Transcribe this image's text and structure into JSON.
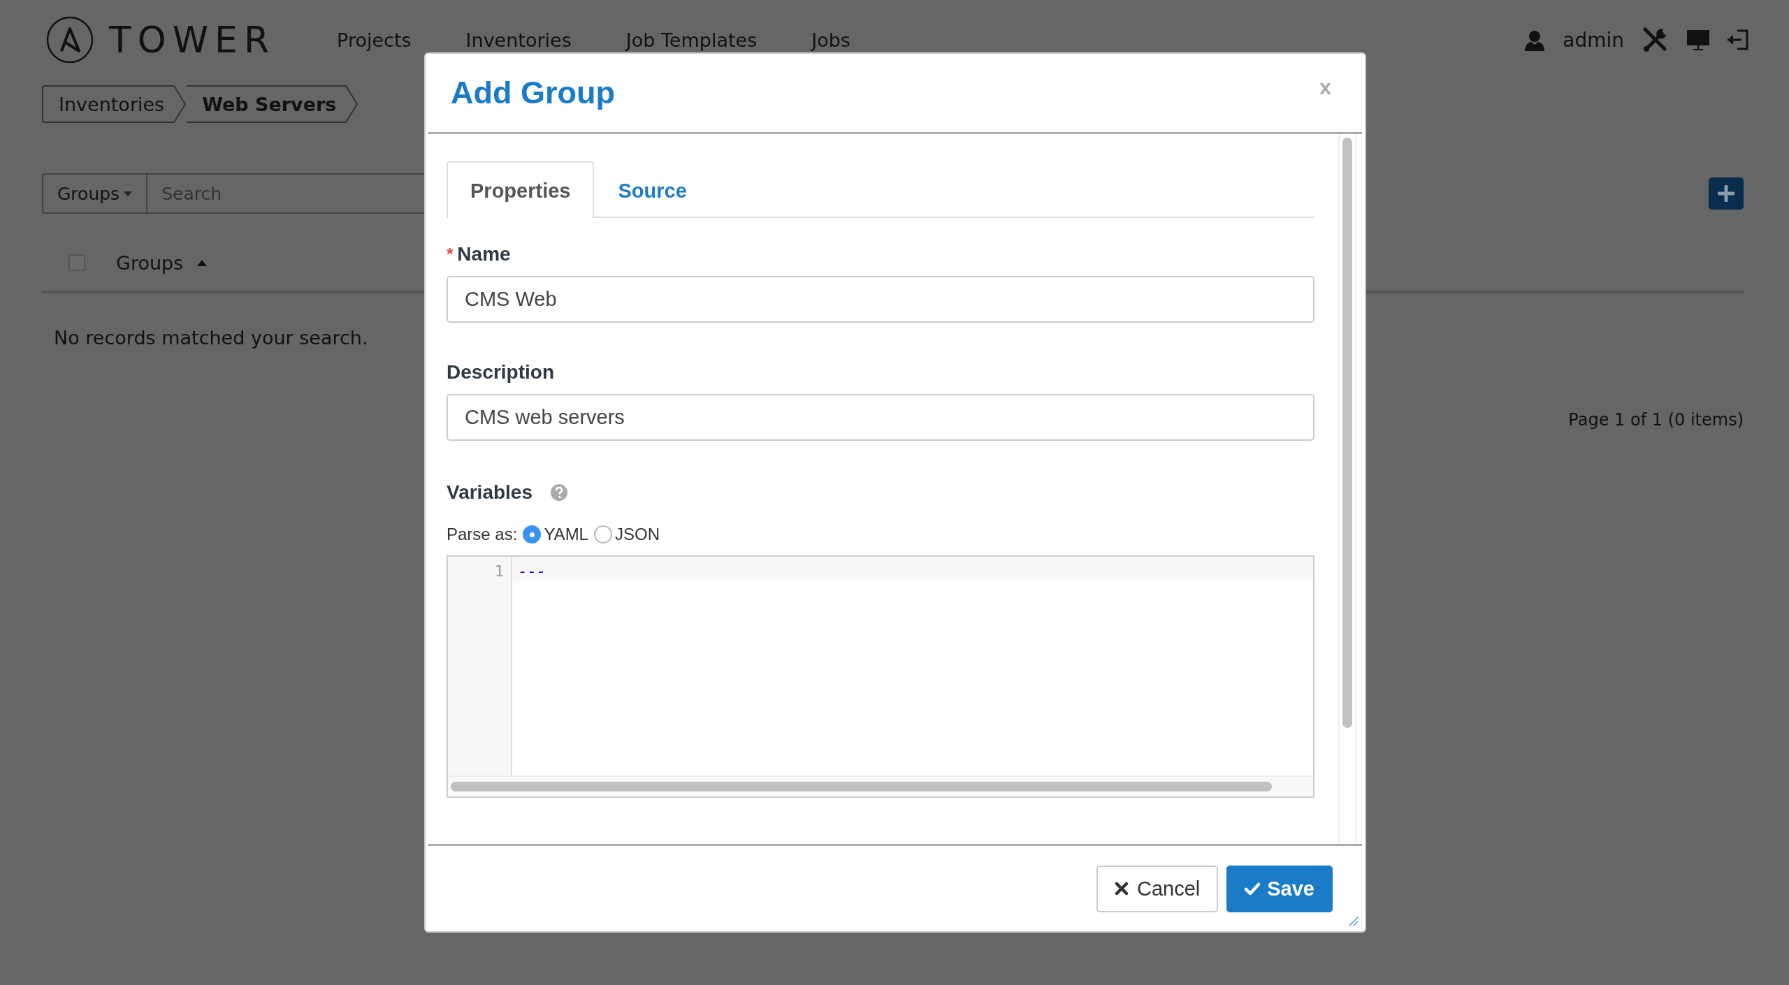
{
  "header": {
    "logo": "TOWER",
    "nav": [
      {
        "label": "Projects"
      },
      {
        "label": "Inventories"
      },
      {
        "label": "Job Templates"
      },
      {
        "label": "Jobs"
      }
    ],
    "user": "admin"
  },
  "breadcrumb": [
    {
      "label": "Inventories",
      "current": false
    },
    {
      "label": "Web Servers",
      "current": true
    }
  ],
  "toolbar": {
    "filter": "Groups",
    "search": {
      "placeholder": "Search"
    }
  },
  "table": {
    "select_all": {
      "checked": false
    },
    "columns": [
      {
        "label": "Groups"
      }
    ],
    "empty_message": "No records matched your search.",
    "pagination": "Page 1 of 1 (0 items)"
  },
  "modal": {
    "title": "Add Group",
    "close": "x",
    "required_mark": "*",
    "tabs": [
      {
        "label": "Properties",
        "selected": true
      },
      {
        "label": "Source",
        "selected": false
      }
    ],
    "fields": [
      {
        "label": "Name",
        "required": true,
        "value": "CMS Web"
      },
      {
        "label": "Description",
        "required": false,
        "value": "CMS web servers"
      }
    ],
    "variables": {
      "label": "Variables",
      "parse_label": "Parse as:",
      "formats": [
        {
          "label": "YAML",
          "selected": true
        },
        {
          "label": "JSON",
          "selected": false
        }
      ],
      "lines": [
        {
          "number": "1",
          "text": "---"
        }
      ]
    },
    "buttons": [
      {
        "kind": "cancel",
        "label": "Cancel"
      },
      {
        "kind": "save",
        "label": "Save"
      }
    ]
  }
}
